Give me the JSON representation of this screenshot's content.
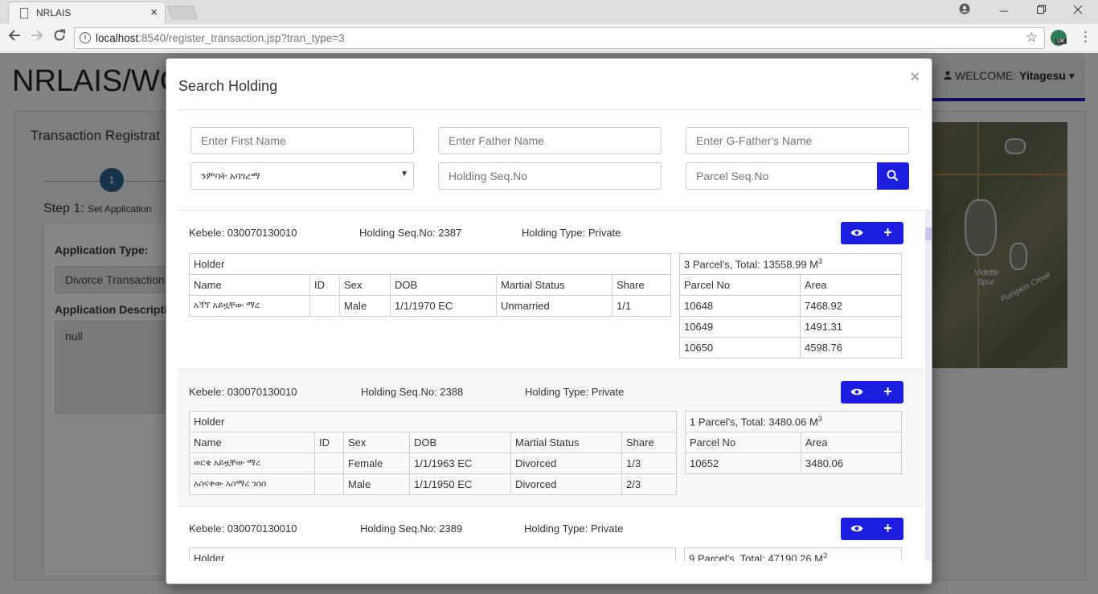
{
  "browser": {
    "tab_title": "NRLAIS",
    "tab_close": "×",
    "url_host": "localhost",
    "url_rest": ":8540/register_transaction.jsp?tran_type=3",
    "ext_badge": "UK"
  },
  "page": {
    "brand": "NRLAIS/WC",
    "welcome_prefix": "WELCOME:",
    "welcome_user": "Yitagesu",
    "card_title": "Transaction Registrat",
    "step_number": "1",
    "step_label": "Step 1:",
    "step_sub": "Set Application",
    "application_type_label": "Application Type:",
    "application_type_value": "Divorce Transaction",
    "application_desc_label": "Application Descripti",
    "application_desc_value": "null",
    "map_text_1": "Vidette",
    "map_text_2": "Spur",
    "map_text_3": "Pumpkin Creek"
  },
  "modal": {
    "title": "Search Holding",
    "close": "×",
    "first_name_placeholder": "Enter First Name",
    "father_name_placeholder": "Enter Father Name",
    "gfather_name_placeholder": "Enter G-Father's Name",
    "kebele_select_value": "ንምባት አባገረማ",
    "holding_seq_placeholder": "Holding Seq.No",
    "parcel_seq_placeholder": "Parcel Seq.No"
  },
  "holdings": [
    {
      "kebele": "Kebele: 030070130010",
      "seq": "Holding Seq.No: 2387",
      "type": "Holding Type: Private",
      "holder_header": "Holder",
      "holder_cols": [
        "Name",
        "ID",
        "Sex",
        "DOB",
        "Martial Status",
        "Share"
      ],
      "holders": [
        [
          "አጘኘ አይዟቸው ማረ",
          "",
          "Male",
          "1/1/1970 EC",
          "Unmarried",
          "1/1"
        ]
      ],
      "parcel_summary": "3 Parcel's, Total: 13558.99 M",
      "parcel_sup": "3",
      "parcel_cols": [
        "Parcel No",
        "Area"
      ],
      "parcels": [
        [
          "10648",
          "7468.92"
        ],
        [
          "10649",
          "1491.31"
        ],
        [
          "10650",
          "4598.76"
        ]
      ]
    },
    {
      "kebele": "Kebele: 030070130010",
      "seq": "Holding Seq.No: 2388",
      "type": "Holding Type: Private",
      "holder_header": "Holder",
      "holder_cols": [
        "Name",
        "ID",
        "Sex",
        "DOB",
        "Martial Status",
        "Share"
      ],
      "holders": [
        [
          "ወርቄ አይዟቸው ማረ",
          "",
          "Female",
          "1/1/1963 EC",
          "Divorced",
          "1/3"
        ],
        [
          "አስናቀው አስማረ ገሰሰ",
          "",
          "Male",
          "1/1/1950 EC",
          "Divorced",
          "2/3"
        ]
      ],
      "parcel_summary": "1 Parcel's, Total: 3480.06 M",
      "parcel_sup": "3",
      "parcel_cols": [
        "Parcel No",
        "Area"
      ],
      "parcels": [
        [
          "10652",
          "3480.06"
        ]
      ]
    },
    {
      "kebele": "Kebele: 030070130010",
      "seq": "Holding Seq.No: 2389",
      "type": "Holding Type: Private",
      "holder_header": "Holder",
      "parcel_summary": "9 Parcel's, Total: 47190.26 M",
      "parcel_sup": "3"
    }
  ],
  "colors": {
    "accent": "#1d1de0",
    "welcome_underline": "#1a1ab8",
    "step_circle": "#2d5d8a"
  },
  "icons": [
    "doc-icon",
    "back-icon",
    "forward-icon",
    "reload-icon",
    "info-icon",
    "star-icon",
    "menu-icon",
    "user-icon",
    "search-icon",
    "eye-icon",
    "plus-icon",
    "close-icon"
  ]
}
